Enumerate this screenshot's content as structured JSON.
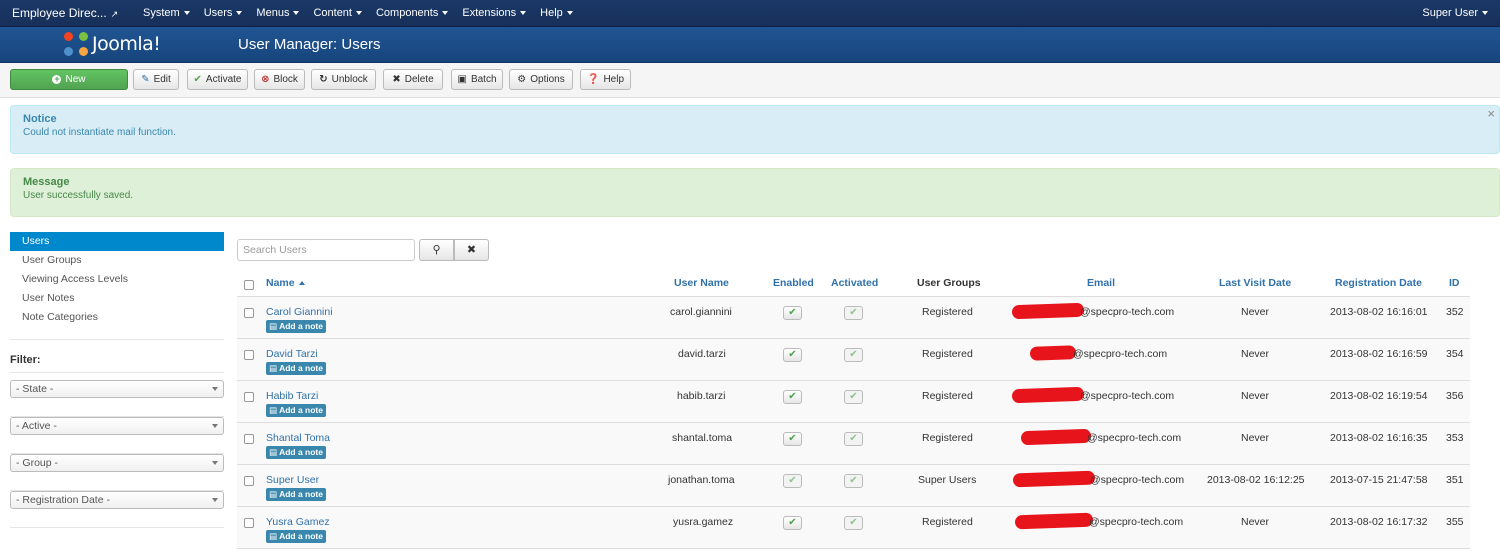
{
  "topbar": {
    "site_name": "Employee Direc...",
    "menu": [
      "System",
      "Users",
      "Menus",
      "Content",
      "Components",
      "Extensions",
      "Help"
    ],
    "user": "Super User"
  },
  "header": {
    "logo_text": "Joomla!",
    "title": "User Manager: Users"
  },
  "toolbar": {
    "new": "New",
    "edit": "Edit",
    "activate": "Activate",
    "block": "Block",
    "unblock": "Unblock",
    "delete": "Delete",
    "batch": "Batch",
    "options": "Options",
    "help": "Help"
  },
  "alerts": {
    "notice_heading": "Notice",
    "notice_text": "Could not instantiate mail function.",
    "message_heading": "Message",
    "message_text": "User successfully saved."
  },
  "sidebar": {
    "items": [
      "Users",
      "User Groups",
      "Viewing Access Levels",
      "User Notes",
      "Note Categories"
    ],
    "filter_label": "Filter:",
    "filters": [
      "- State -",
      "- Active -",
      "- Group -",
      "- Registration Date -"
    ]
  },
  "search": {
    "placeholder": "Search Users"
  },
  "table": {
    "headers": {
      "name": "Name",
      "username": "User Name",
      "enabled": "Enabled",
      "activated": "Activated",
      "groups": "User Groups",
      "email": "Email",
      "last_visit": "Last Visit Date",
      "registration": "Registration Date",
      "id": "ID"
    },
    "note_label": "Add a note",
    "rows": [
      {
        "name": "Carol Giannini",
        "username": "carol.giannini",
        "groups": "Registered",
        "email": "@specpro-tech.com",
        "last_visit": "Never",
        "registration": "2013-08-02 16:16:01",
        "id": "352"
      },
      {
        "name": "David Tarzi",
        "username": "david.tarzi",
        "groups": "Registered",
        "email": "@specpro-tech.com",
        "last_visit": "Never",
        "registration": "2013-08-02 16:16:59",
        "id": "354"
      },
      {
        "name": "Habib Tarzi",
        "username": "habib.tarzi",
        "groups": "Registered",
        "email": "@specpro-tech.com",
        "last_visit": "Never",
        "registration": "2013-08-02 16:19:54",
        "id": "356"
      },
      {
        "name": "Shantal Toma",
        "username": "shantal.toma",
        "groups": "Registered",
        "email": "@specpro-tech.com",
        "last_visit": "Never",
        "registration": "2013-08-02 16:16:35",
        "id": "353"
      },
      {
        "name": "Super User",
        "username": "jonathan.toma",
        "groups": "Super Users",
        "email": "@specpro-tech.com",
        "last_visit": "2013-08-02 16:12:25",
        "registration": "2013-07-15 21:47:58",
        "id": "351"
      },
      {
        "name": "Yusra Gamez",
        "username": "yusra.gamez",
        "groups": "Registered",
        "email": "@specpro-tech.com",
        "last_visit": "Never",
        "registration": "2013-08-02 16:17:32",
        "id": "355"
      }
    ]
  }
}
